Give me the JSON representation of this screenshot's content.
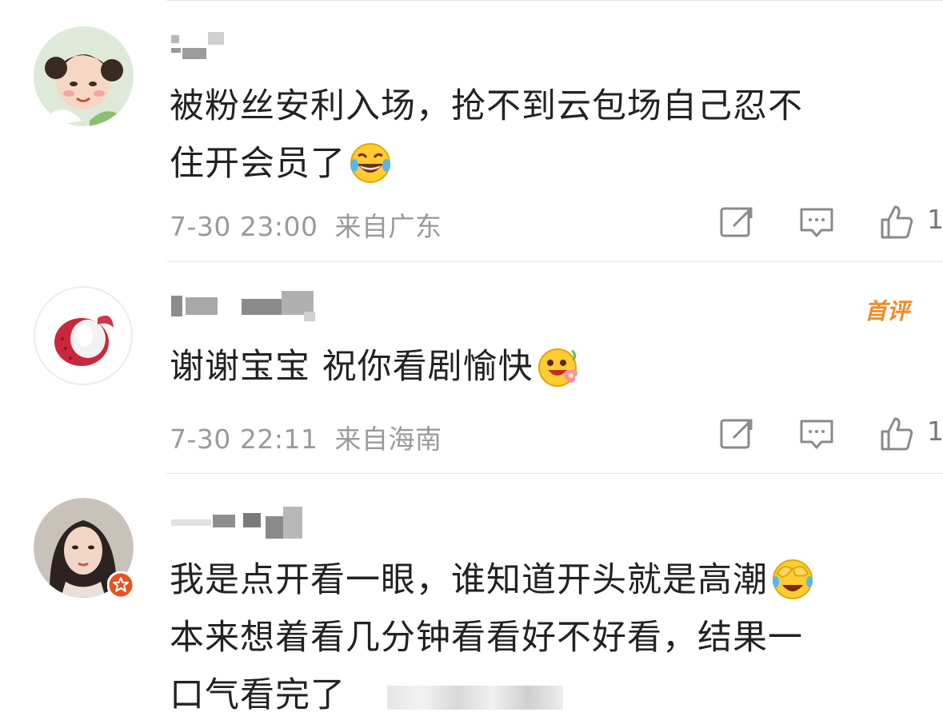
{
  "comments": [
    {
      "text_lines": [
        "被粉丝安利入场，抢不到云包场自己忍不",
        "住开会员了"
      ],
      "emoji": "laugh-cry-emoji",
      "time": "7-30 23:00",
      "location": "来自广东",
      "likes": "1"
    },
    {
      "text_lines": [
        "谢谢宝宝 祝你看剧愉快"
      ],
      "emoji": "flower-smile-emoji",
      "badge": "首评",
      "time": "7-30 22:11",
      "location": "来自海南",
      "likes": "1"
    },
    {
      "text_lines": [
        "我是点开看一眼，谁知道开头就是高潮",
        "本来想着看几分钟看看好不好看，结果一",
        "口气看完了"
      ],
      "emoji": "facepalm-laugh-emoji"
    }
  ],
  "colors": {
    "text": "#222222",
    "meta": "#9a9a9a",
    "badge": "#f08a24",
    "verified": "#e8531f",
    "divider": "#e6e6e6"
  }
}
